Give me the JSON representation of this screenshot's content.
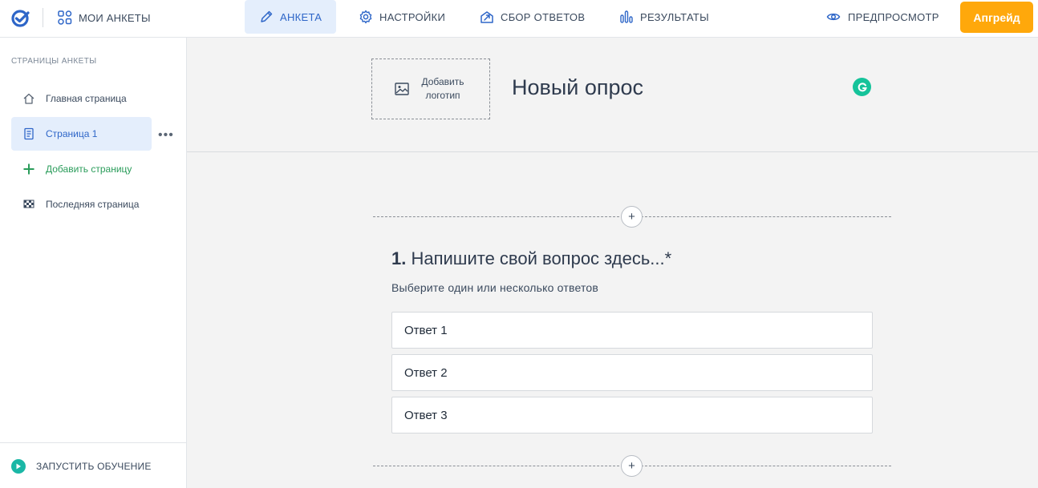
{
  "topbar": {
    "my_surveys": "МОИ АНКЕТЫ",
    "nav": [
      {
        "label": "АНКЕТА",
        "icon": "pencil-icon",
        "active": true
      },
      {
        "label": "НАСТРОЙКИ",
        "icon": "gear-icon",
        "active": false
      },
      {
        "label": "СБОР ОТВЕТОВ",
        "icon": "share-icon",
        "active": false
      },
      {
        "label": "РЕЗУЛЬТАТЫ",
        "icon": "bar-chart-icon",
        "active": false
      }
    ],
    "preview": "ПРЕДПРОСМОТР",
    "upgrade": "Апгрейд",
    "colors": {
      "accent": "#2e66c8",
      "active_bg": "#e4eefc",
      "upgrade": "#ffa80b"
    }
  },
  "sidebar": {
    "title": "СТРАНИЦЫ АНКЕТЫ",
    "items": [
      {
        "label": "Главная страница",
        "icon": "home-icon"
      },
      {
        "label": "Страница 1",
        "icon": "page-icon",
        "active": true
      },
      {
        "label": "Добавить страницу",
        "icon": "plus-icon"
      },
      {
        "label": "Последняя страница",
        "icon": "finish-flag-icon"
      }
    ],
    "more": "•••",
    "tutorial": "ЗАПУСТИТЬ ОБУЧЕНИЕ"
  },
  "main": {
    "logo_box": "Добавить логотип",
    "survey_title": "Новый опрос",
    "question": {
      "number": "1.",
      "text": "Напишите свой вопрос здесь...*",
      "description": "Выберите один или несколько ответов",
      "answers": [
        "Ответ 1",
        "Ответ 2",
        "Ответ 3"
      ]
    },
    "add_symbol": "+"
  }
}
